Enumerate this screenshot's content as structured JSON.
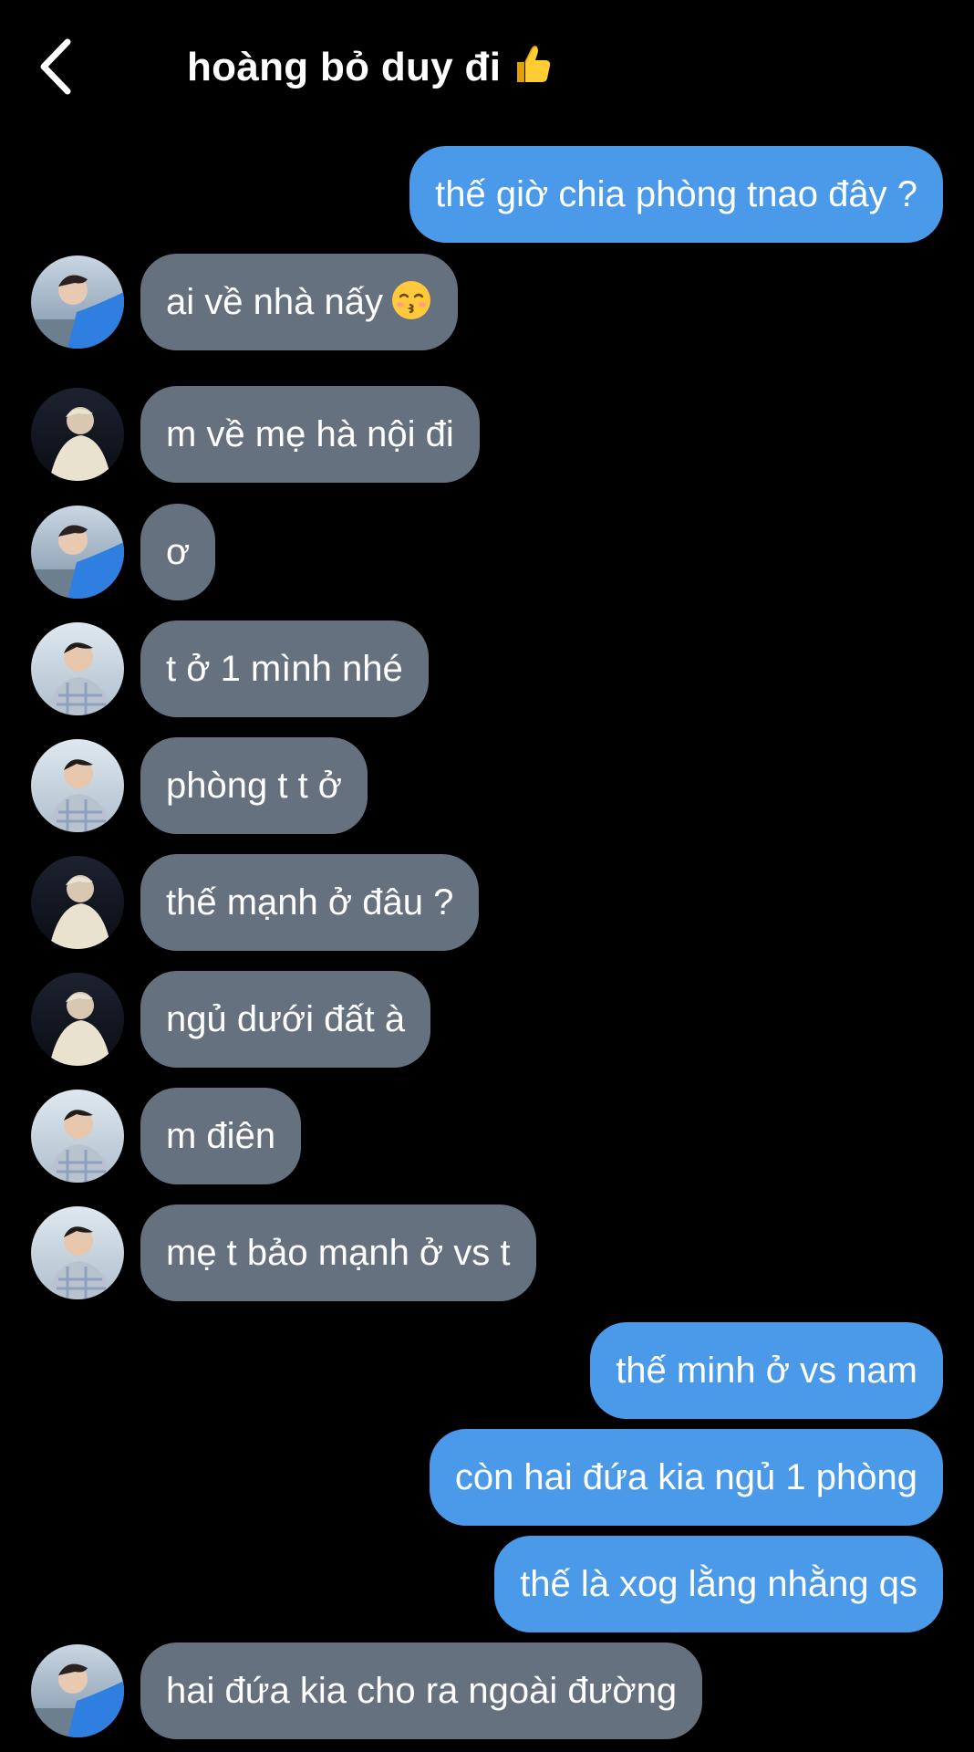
{
  "header": {
    "title": "hoàng bỏ duy đi",
    "title_icon": "thumbs-up-icon",
    "back_icon": "chevron-left-icon"
  },
  "colors": {
    "background": "#000000",
    "incoming_bubble": "#66717f",
    "outgoing_bubble": "#4a9ae9",
    "text": "#ffffff"
  },
  "messages": [
    {
      "side": "out",
      "text": "thế giờ chia phòng tnao đây ?"
    },
    {
      "side": "in",
      "avatar": "avatar-blue-jacket",
      "text": "ai về nhà nấy",
      "emoji": "kissing-face-icon"
    },
    {
      "side": "in",
      "avatar": "avatar-white-cloak",
      "text": "m về mẹ hà nội đi"
    },
    {
      "side": "in",
      "avatar": "avatar-blue-jacket",
      "text": "ơ"
    },
    {
      "side": "in",
      "avatar": "avatar-plaid-shirt",
      "text": "t ở 1 mình nhé"
    },
    {
      "side": "in",
      "avatar": "avatar-plaid-shirt",
      "text": "phòng t t ở"
    },
    {
      "side": "in",
      "avatar": "avatar-white-cloak",
      "text": "thế mạnh ở đâu ?"
    },
    {
      "side": "in",
      "avatar": "avatar-white-cloak",
      "text": "ngủ dưới đất à"
    },
    {
      "side": "in",
      "avatar": "avatar-plaid-shirt",
      "text": "m điên"
    },
    {
      "side": "in",
      "avatar": "avatar-plaid-shirt",
      "text": "mẹ t bảo mạnh ở vs t"
    },
    {
      "side": "out",
      "text": "thế minh ở vs nam"
    },
    {
      "side": "out",
      "text": "còn hai đứa kia ngủ 1 phòng"
    },
    {
      "side": "out",
      "text": "thế là xog lằng nhằng qs"
    },
    {
      "side": "in",
      "avatar": "avatar-blue-jacket",
      "text": "hai đứa kia cho ra ngoài đường"
    }
  ]
}
